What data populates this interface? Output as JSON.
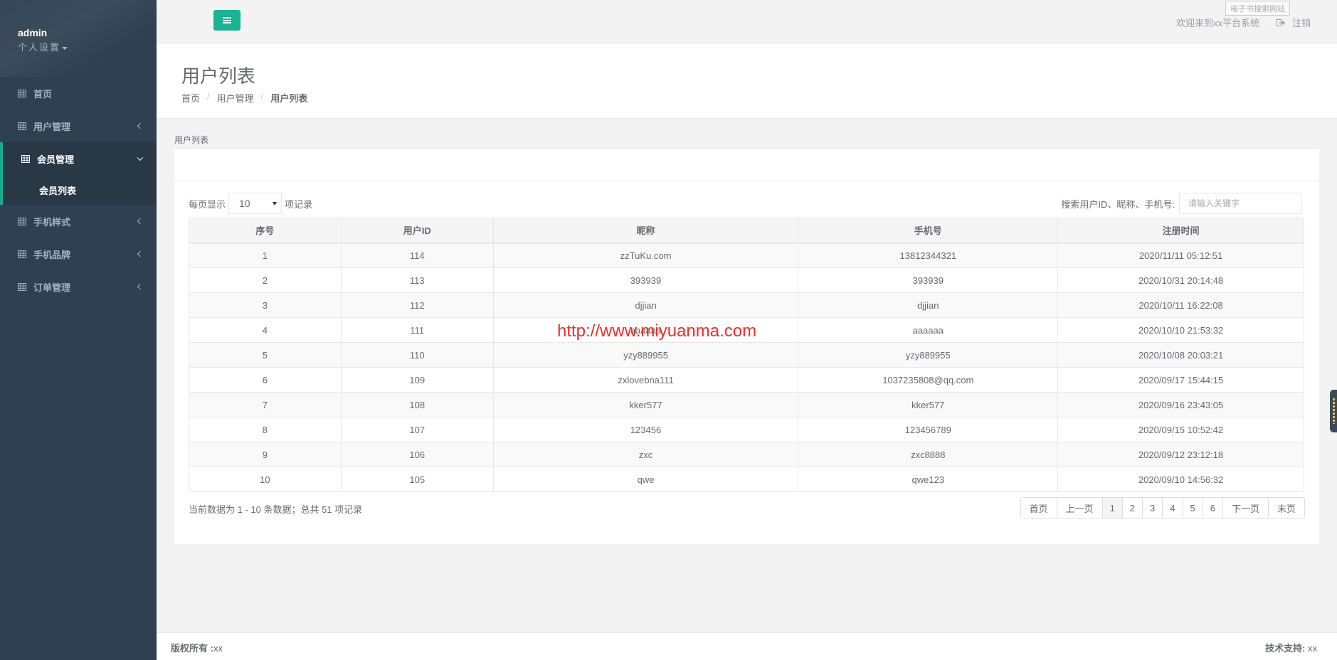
{
  "sidebar": {
    "profile_name": "admin",
    "profile_settings": "个人设置",
    "items": [
      {
        "label": "首页",
        "has_chevron": false
      },
      {
        "label": "用户管理",
        "has_chevron": true
      },
      {
        "label": "会员管理",
        "has_chevron": true,
        "active": true
      },
      {
        "label": "手机样式",
        "has_chevron": true
      },
      {
        "label": "手机品牌",
        "has_chevron": true
      },
      {
        "label": "订单管理",
        "has_chevron": true
      }
    ],
    "subitem": "会员列表"
  },
  "topbar": {
    "welcome": "欢迎来到xx平台系统",
    "logout": "注销",
    "tooltip": "电子书搜索网站"
  },
  "heading": {
    "title": "用户列表",
    "breadcrumb": [
      "首页",
      "用户管理",
      "用户列表"
    ]
  },
  "panel": {
    "title": "用户列表",
    "length_prefix": "每页显示",
    "length_value": "10",
    "length_suffix": "项记录",
    "search_label": "搜索用户ID、昵称、手机号:",
    "search_placeholder": "请输入关键字"
  },
  "table": {
    "columns": [
      "序号",
      "用户ID",
      "昵称",
      "手机号",
      "注册时间"
    ],
    "rows": [
      [
        "1",
        "114",
        "zzTuKu.com",
        "13812344321",
        "2020/11/11 05:12:51"
      ],
      [
        "2",
        "113",
        "393939",
        "393939",
        "2020/10/31 20:14:48"
      ],
      [
        "3",
        "112",
        "djjian",
        "djjian",
        "2020/10/11 16:22:08"
      ],
      [
        "4",
        "111",
        "aaaaaa",
        "aaaaaa",
        "2020/10/10 21:53:32"
      ],
      [
        "5",
        "110",
        "yzy889955",
        "yzy889955",
        "2020/10/08 20:03:21"
      ],
      [
        "6",
        "109",
        "zxlovebna111",
        "1037235808@qq.com",
        "2020/09/17 15:44:15"
      ],
      [
        "7",
        "108",
        "kker577",
        "kker577",
        "2020/09/16 23:43:05"
      ],
      [
        "8",
        "107",
        "123456",
        "123456789",
        "2020/09/15 10:52:42"
      ],
      [
        "9",
        "106",
        "zxc",
        "zxc8888",
        "2020/09/12 23:12:18"
      ],
      [
        "10",
        "105",
        "qwe",
        "qwe123",
        "2020/09/10 14:56:32"
      ]
    ]
  },
  "pagination": {
    "info": "当前数据为 1 - 10 条数据；总共 51 项记录",
    "first": "首页",
    "prev": "上一页",
    "pages": [
      "1",
      "2",
      "3",
      "4",
      "5",
      "6"
    ],
    "current": "1",
    "next": "下一页",
    "last": "末页"
  },
  "watermark": "http://www.miyuanma.com",
  "footer": {
    "copyright_label": "版权所有 :",
    "copyright_value": "xx",
    "support_label": "技术支持:",
    "support_value": "xx"
  },
  "colors": {
    "sidebar_bg": "#2f4050",
    "accent": "#1ab394",
    "watermark": "#e8302e"
  }
}
